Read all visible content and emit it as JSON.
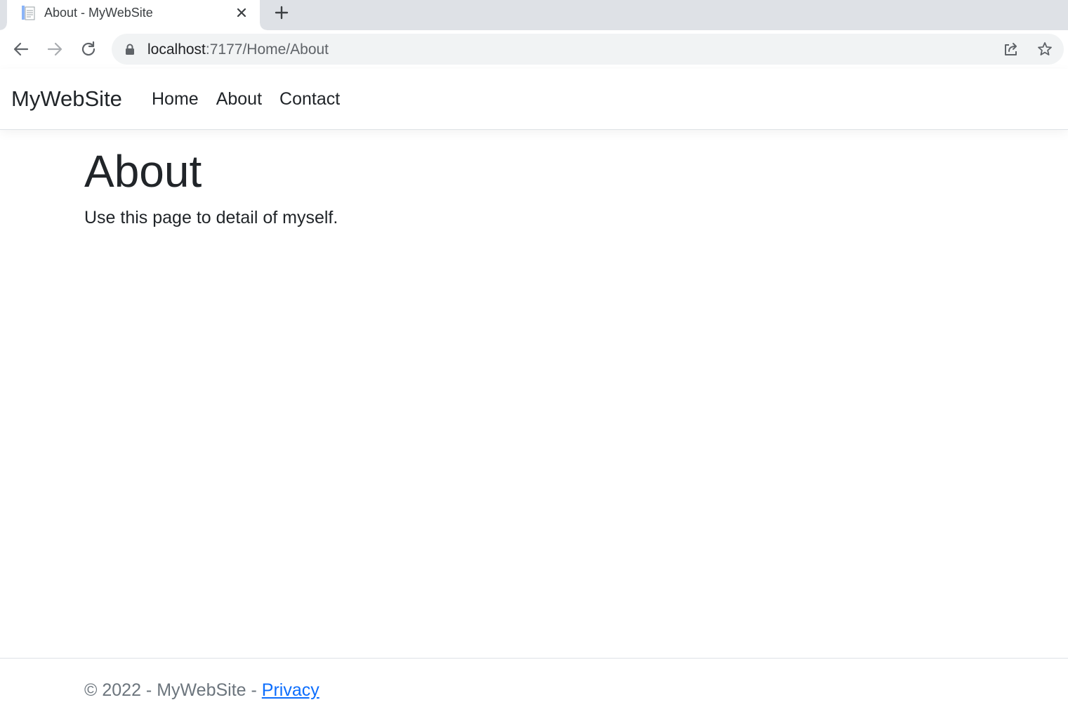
{
  "browser": {
    "tab_title": "About - MyWebSite",
    "url_host": "localhost",
    "url_path": ":7177/Home/About",
    "icons": [
      "document-favicon-icon",
      "close-icon",
      "plus-icon",
      "back-arrow-icon",
      "forward-arrow-icon",
      "reload-icon",
      "lock-icon",
      "share-icon",
      "star-icon"
    ]
  },
  "site": {
    "brand": "MyWebSite",
    "nav": [
      "Home",
      "About",
      "Contact"
    ]
  },
  "main": {
    "title": "About",
    "description": "Use this page to detail of myself."
  },
  "footer": {
    "copyright": "© 2022 - MyWebSite - ",
    "privacy_link": "Privacy"
  },
  "colors": {
    "tabstrip_bg": "#dee1e6",
    "omnibox_bg": "#f1f3f4",
    "text": "#212529",
    "muted": "#6c757d",
    "link": "#0d6efd"
  }
}
